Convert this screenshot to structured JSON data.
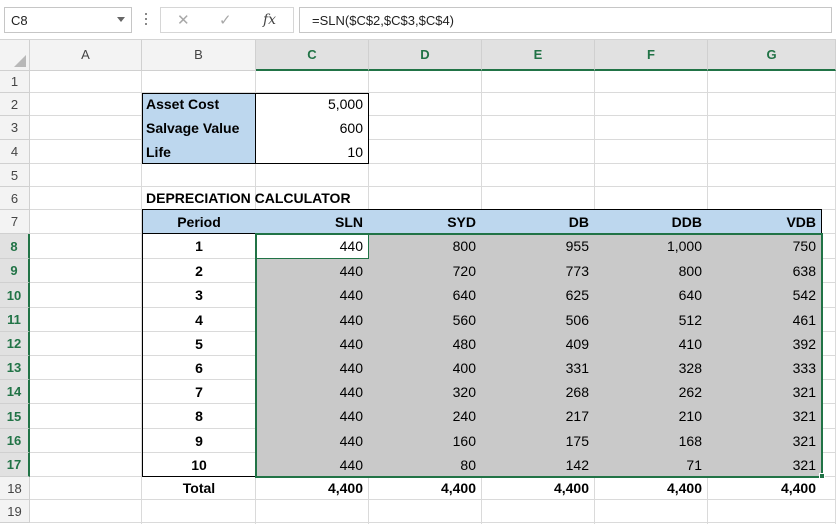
{
  "name_box": "C8",
  "formula": "=SLN($C$2,$C$3,$C$4)",
  "formula_buttons": {
    "cancel": "✕",
    "enter": "✓",
    "fx": "fx"
  },
  "columns": [
    "A",
    "B",
    "C",
    "D",
    "E",
    "F",
    "G"
  ],
  "selected_columns": [
    "C",
    "D",
    "E",
    "F",
    "G"
  ],
  "rows": [
    "1",
    "2",
    "3",
    "4",
    "5",
    "6",
    "7",
    "8",
    "9",
    "10",
    "11",
    "12",
    "13",
    "14",
    "15",
    "16",
    "17",
    "18",
    "19"
  ],
  "selected_rows": [
    "8",
    "9",
    "10",
    "11",
    "12",
    "13",
    "14",
    "15",
    "16",
    "17"
  ],
  "inputs": [
    {
      "label": "Asset Cost",
      "value": "5,000"
    },
    {
      "label": "Salvage Value",
      "value": "600"
    },
    {
      "label": "Life",
      "value": "10"
    }
  ],
  "calc_title": "DEPRECIATION CALCULATOR",
  "table_headers": [
    "Period",
    "SLN",
    "SYD",
    "DB",
    "DDB",
    "VDB"
  ],
  "table_rows": [
    [
      "1",
      "440",
      "800",
      "955",
      "1,000",
      "750"
    ],
    [
      "2",
      "440",
      "720",
      "773",
      "800",
      "638"
    ],
    [
      "3",
      "440",
      "640",
      "625",
      "640",
      "542"
    ],
    [
      "4",
      "440",
      "560",
      "506",
      "512",
      "461"
    ],
    [
      "5",
      "440",
      "480",
      "409",
      "410",
      "392"
    ],
    [
      "6",
      "440",
      "400",
      "331",
      "328",
      "333"
    ],
    [
      "7",
      "440",
      "320",
      "268",
      "262",
      "321"
    ],
    [
      "8",
      "440",
      "240",
      "217",
      "210",
      "321"
    ],
    [
      "9",
      "440",
      "160",
      "175",
      "168",
      "321"
    ],
    [
      "10",
      "440",
      "80",
      "142",
      "71",
      "321"
    ]
  ],
  "totals": [
    "Total",
    "4,400",
    "4,400",
    "4,400",
    "4,400",
    "4,400"
  ],
  "colors": {
    "accent": "#217346",
    "input_fill": "#bdd7ee",
    "selection_fill": "#c9c9c9"
  }
}
